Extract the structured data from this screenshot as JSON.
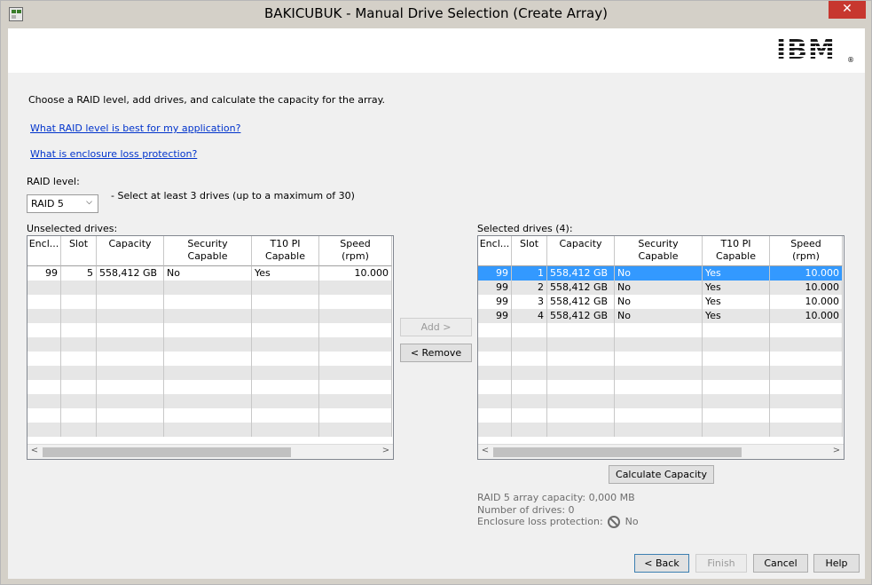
{
  "window": {
    "title": "BAKICUBUK - Manual Drive Selection (Create Array)",
    "close_glyph": "✕",
    "icon": "app-window-icon"
  },
  "logo": {
    "text": "IBM",
    "reg": "®"
  },
  "intro": "Choose a RAID level, add drives, and calculate the capacity for the array.",
  "links": {
    "raid_best": "What RAID level is best for my application?",
    "enclosure_loss": "What is enclosure loss protection?"
  },
  "raid": {
    "label": "RAID level:",
    "selected": "RAID 5",
    "hint": "- Select at least 3 drives (up to a maximum of 30)"
  },
  "unselected": {
    "label": "Unselected drives:",
    "headers": [
      {
        "line1": "Encl...",
        "line2": ""
      },
      {
        "line1": "Slot",
        "line2": ""
      },
      {
        "line1": "Capacity",
        "line2": ""
      },
      {
        "line1": "Security",
        "line2": "Capable"
      },
      {
        "line1": "T10 PI",
        "line2": "Capable"
      },
      {
        "line1": "Speed",
        "line2": "(rpm)"
      }
    ],
    "rows": [
      [
        "99",
        "5",
        "558,412 GB",
        "No",
        "Yes",
        "10.000"
      ]
    ]
  },
  "selected": {
    "label": "Selected drives (4):",
    "headers": [
      {
        "line1": "Encl...",
        "line2": ""
      },
      {
        "line1": "Slot",
        "line2": ""
      },
      {
        "line1": "Capacity",
        "line2": ""
      },
      {
        "line1": "Security",
        "line2": "Capable"
      },
      {
        "line1": "T10 PI",
        "line2": "Capable"
      },
      {
        "line1": "Speed",
        "line2": "(rpm)"
      }
    ],
    "rows": [
      [
        "99",
        "1",
        "558,412 GB",
        "No",
        "Yes",
        "10.000"
      ],
      [
        "99",
        "2",
        "558,412 GB",
        "No",
        "Yes",
        "10.000"
      ],
      [
        "99",
        "3",
        "558,412 GB",
        "No",
        "Yes",
        "10.000"
      ],
      [
        "99",
        "4",
        "558,412 GB",
        "No",
        "Yes",
        "10.000"
      ]
    ],
    "selected_row_index": 0
  },
  "scroll": {
    "left": "<",
    "right": ">"
  },
  "buttons": {
    "add": "Add >",
    "remove": "< Remove",
    "calculate": "Calculate Capacity",
    "back": "< Back",
    "finish": "Finish",
    "cancel": "Cancel",
    "help": "Help"
  },
  "summary": {
    "capacity": "RAID 5 array capacity: 0,000 MB",
    "drives": "Number of drives: 0",
    "enclosure_label": "Enclosure loss protection:",
    "enclosure_value": "No"
  },
  "colors": {
    "selection": "#3399ff",
    "link": "#0033cc",
    "close": "#c7372f"
  }
}
